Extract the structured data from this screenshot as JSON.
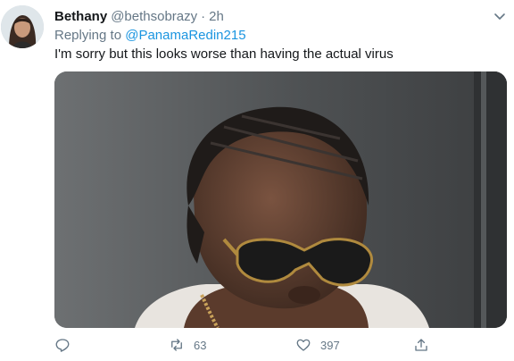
{
  "tweet": {
    "author": {
      "name": "Bethany",
      "handle": "@bethsobrazy",
      "separator": "·",
      "time": "2h"
    },
    "replying": {
      "prefix": "Replying to",
      "mention": "@PanamaRedin215"
    },
    "text": "I'm sorry but this looks worse than having the actual virus",
    "media": {
      "type": "image",
      "icon": "photo"
    },
    "actions": {
      "reply": {
        "icon": "reply-icon",
        "count": ""
      },
      "retweet": {
        "icon": "retweet-icon",
        "count": "63"
      },
      "like": {
        "icon": "heart-icon",
        "count": "397"
      },
      "share": {
        "icon": "share-icon",
        "count": ""
      }
    },
    "colors": {
      "link": "#1b95e0",
      "secondary": "#657786",
      "text": "#14171a"
    }
  }
}
